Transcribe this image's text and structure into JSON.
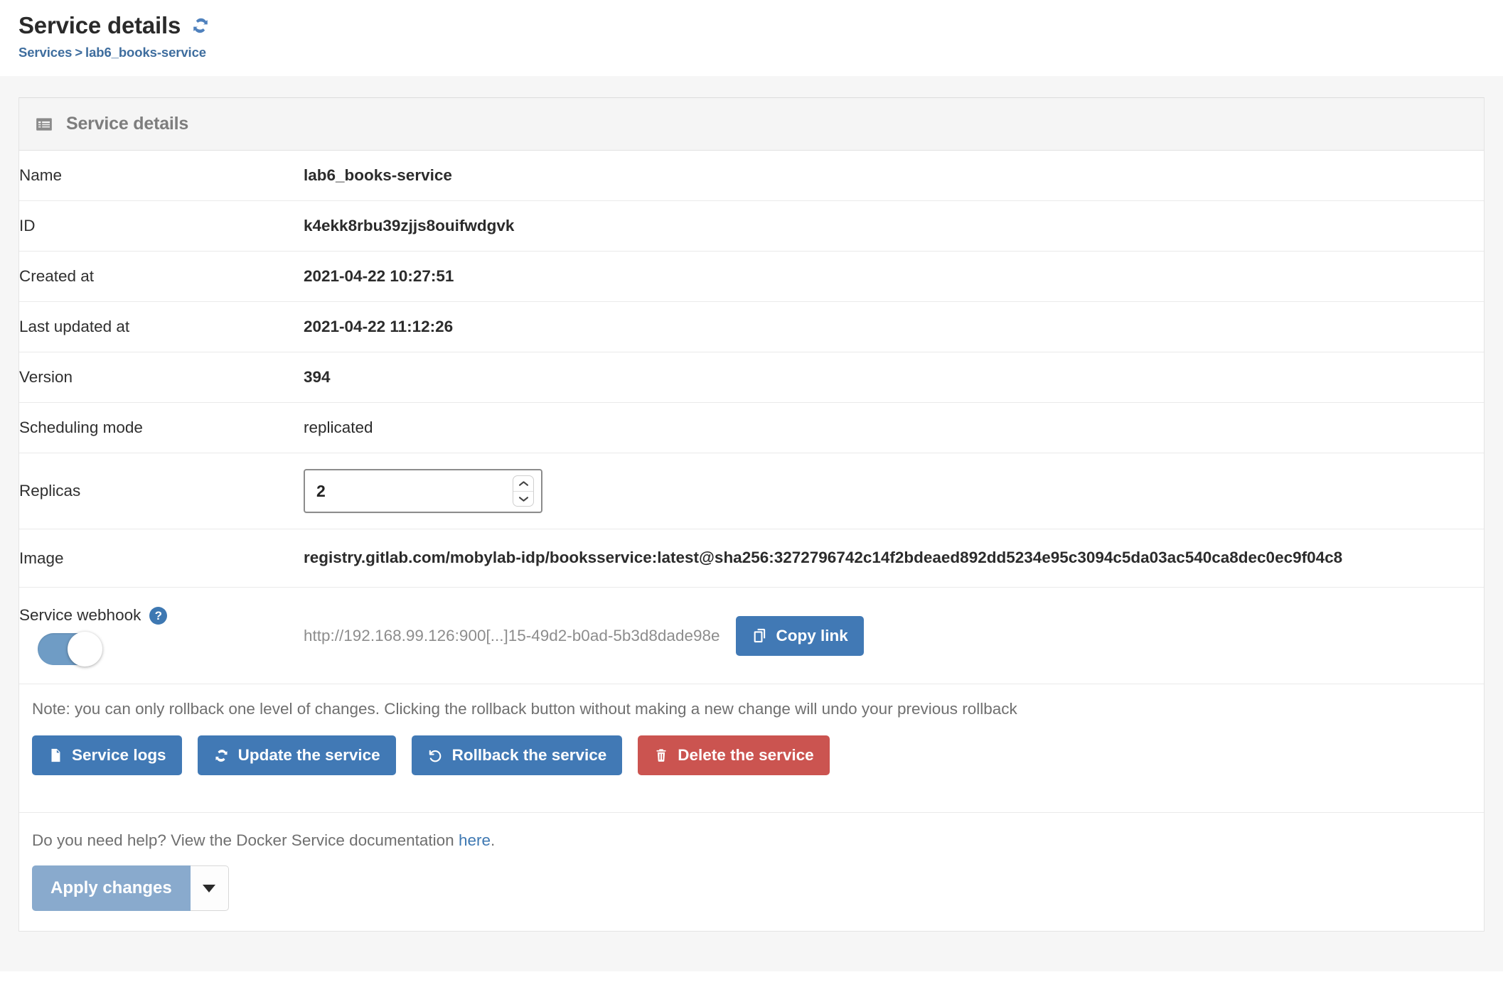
{
  "header": {
    "title": "Service details",
    "refresh_icon": "refresh-icon",
    "breadcrumb": {
      "root": "Services",
      "separator": ">",
      "current": "lab6_books-service"
    }
  },
  "panel": {
    "icon": "table-list-icon",
    "title": "Service details"
  },
  "details": {
    "rows": [
      {
        "key": "Name",
        "value": "lab6_books-service"
      },
      {
        "key": "ID",
        "value": "k4ekk8rbu39zjjs8ouifwdgvk"
      },
      {
        "key": "Created at",
        "value": "2021-04-22 10:27:51"
      },
      {
        "key": "Last updated at",
        "value": "2021-04-22 11:12:26"
      },
      {
        "key": "Version",
        "value": "394"
      },
      {
        "key": "Scheduling mode",
        "value": "replicated"
      }
    ],
    "replicas": {
      "key": "Replicas",
      "value": "2"
    },
    "image": {
      "key": "Image",
      "value": "registry.gitlab.com/mobylab-idp/booksservice:latest@sha256:3272796742c14f2bdeaed892dd5234e95c3094c5da03ac540ca8dec0ec9f04c8"
    },
    "webhook": {
      "key": "Service webhook",
      "help_icon": "question-mark-icon",
      "toggle_state": "on",
      "url": "http://192.168.99.126:900[...]15-49d2-b0ad-5b3d8dade98e",
      "copy_button": {
        "label": "Copy link",
        "icon": "copy-icon"
      }
    }
  },
  "note": "Note: you can only rollback one level of changes. Clicking the rollback button without making a new change will undo your previous rollback",
  "actions": [
    {
      "label": "Service logs",
      "icon": "file-text-icon",
      "style": "blue"
    },
    {
      "label": "Update the service",
      "icon": "sync-icon",
      "style": "blue"
    },
    {
      "label": "Rollback the service",
      "icon": "undo-icon",
      "style": "blue"
    },
    {
      "label": "Delete the service",
      "icon": "trash-icon",
      "style": "red"
    }
  ],
  "footer": {
    "help_text_before": "Do you need help? View the Docker Service documentation ",
    "help_link": "here",
    "help_text_after": ".",
    "apply_label": "Apply changes",
    "apply_caret_icon": "chevron-down-icon"
  },
  "colors": {
    "primary_blue": "#4179b5",
    "danger_red": "#cb5450",
    "link_blue": "#3e78b2",
    "toggle_on": "#6f9cc5",
    "apply_muted": "#89aacd"
  }
}
